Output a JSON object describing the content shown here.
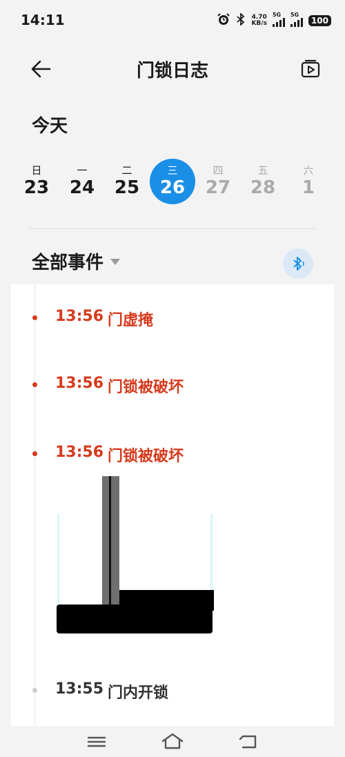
{
  "status_bar": {
    "time": "14:11",
    "net_speed_value": "4.70",
    "net_speed_unit": "KB/s",
    "signal1_label": "5G",
    "signal2_label": "5G",
    "battery": "100"
  },
  "header": {
    "title": "门锁日志",
    "back_icon": "arrow-left-icon",
    "playback_icon": "video-playback-icon"
  },
  "day_label": "今天",
  "calendar": [
    {
      "week": "日",
      "day": "23",
      "state": "past"
    },
    {
      "week": "一",
      "day": "24",
      "state": "past"
    },
    {
      "week": "二",
      "day": "25",
      "state": "past"
    },
    {
      "week": "三",
      "day": "26",
      "state": "selected"
    },
    {
      "week": "四",
      "day": "27",
      "state": "future"
    },
    {
      "week": "五",
      "day": "28",
      "state": "future"
    },
    {
      "week": "六",
      "day": "1",
      "state": "future"
    }
  ],
  "filter": {
    "label": "全部事件",
    "bluetooth_icon": "bluetooth-icon"
  },
  "events": [
    {
      "time": "13:56",
      "text": "门虚掩",
      "level": "alert"
    },
    {
      "time": "13:56",
      "text": "门锁被破坏",
      "level": "alert"
    },
    {
      "time": "13:56",
      "text": "门锁被破坏",
      "level": "alert"
    },
    {
      "time": "13:55",
      "text": "门内开锁",
      "level": "normal"
    }
  ],
  "colors": {
    "accent": "#1b8fe6",
    "alert": "#d63a1d",
    "background": "#f3f3f3"
  },
  "nav_bar": {
    "menu_icon": "menu-icon",
    "home_icon": "home-icon",
    "back_icon": "back-icon"
  }
}
